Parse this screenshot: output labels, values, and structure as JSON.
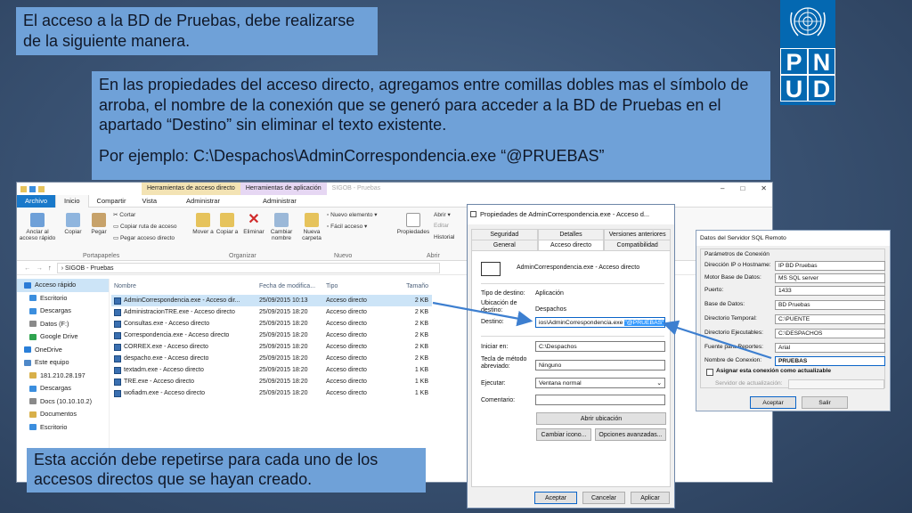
{
  "slide": {
    "heading": "El acceso a la BD de Pruebas, debe realizarse de la siguiente manera.",
    "instructions": "En las propiedades del acceso directo, agregamos entre comillas dobles mas el símbolo de arroba, el nombre de la conexión que se generó para acceder a la BD de Pruebas en el apartado “Destino” sin eliminar el texto existente.",
    "example": "Por ejemplo: C:\\Despachos\\AdminCorrespondencia.exe “@PRUEBAS”",
    "footer_note": "Esta acción debe repetirse para cada uno de los accesos directos que se hayan creado.",
    "logo_letters": [
      "P",
      "N",
      "U",
      "D"
    ]
  },
  "explorer": {
    "context_tabs": [
      "Herramientas de acceso directo",
      "Herramientas de aplicación",
      "SIGOB - Pruebas"
    ],
    "ribbon_tabs": [
      "Archivo",
      "Inicio",
      "Compartir",
      "Vista",
      "Administrar",
      "Administrar"
    ],
    "ribbon": {
      "pin_label": "Anclar al acceso rápido",
      "copy_label": "Copiar",
      "paste_label": "Pegar",
      "cut_label": "Cortar",
      "copy_path_label": "Copiar ruta de acceso",
      "paste_shortcut_label": "Pegar acceso directo",
      "move_to_label": "Mover a",
      "copy_to_label": "Copiar a",
      "delete_label": "Eliminar",
      "rename_label": "Cambiar nombre",
      "new_folder_label": "Nueva carpeta",
      "new_item_label": "Nuevo elemento",
      "easy_access_label": "Fácil acceso",
      "properties_label": "Propiedades",
      "open_label": "Abrir",
      "edit_label": "Editar",
      "history_label": "Historial",
      "groups": [
        "Portapapeles",
        "Organizar",
        "Nuevo",
        "Abrir"
      ]
    },
    "address_path": "SIGOB - Pruebas",
    "nav_items": [
      {
        "label": "Acceso rápido",
        "color": "#2b7bd6"
      },
      {
        "label": "Escritorio",
        "color": "#3b8ede"
      },
      {
        "label": "Descargas",
        "color": "#3b8ede"
      },
      {
        "label": "Datos (F:)",
        "color": "#8a8a8a"
      },
      {
        "label": "Google Drive",
        "color": "#2fa34f"
      },
      {
        "label": "OneDrive",
        "color": "#2a7fd8"
      },
      {
        "label": "Este equipo",
        "color": "#4e88c8"
      },
      {
        "label": "181.210.28.197",
        "color": "#d8b04a"
      },
      {
        "label": "Descargas",
        "color": "#3b8ede"
      },
      {
        "label": "Docs (10.10.10.2)",
        "color": "#8a8a8a"
      },
      {
        "label": "Documentos",
        "color": "#d8b04a"
      },
      {
        "label": "Escritorio",
        "color": "#3b8ede"
      }
    ],
    "columns": [
      "Nombre",
      "Fecha de modifica...",
      "Tipo",
      "Tamaño"
    ],
    "files": [
      {
        "name": "AdminCorrespondencia.exe - Acceso dir...",
        "date": "25/09/2015 10:13",
        "type": "Acceso directo",
        "size": "2 KB"
      },
      {
        "name": "AdministracionTRE.exe - Acceso directo",
        "date": "25/09/2015 18:20",
        "type": "Acceso directo",
        "size": "2 KB"
      },
      {
        "name": "Consultas.exe - Acceso directo",
        "date": "25/09/2015 18:20",
        "type": "Acceso directo",
        "size": "2 KB"
      },
      {
        "name": "Correspondencia.exe - Acceso directo",
        "date": "25/09/2015 18:20",
        "type": "Acceso directo",
        "size": "2 KB"
      },
      {
        "name": "CORREX.exe - Acceso directo",
        "date": "25/09/2015 18:20",
        "type": "Acceso directo",
        "size": "2 KB"
      },
      {
        "name": "despacho.exe - Acceso directo",
        "date": "25/09/2015 18:20",
        "type": "Acceso directo",
        "size": "2 KB"
      },
      {
        "name": "textadm.exe - Acceso directo",
        "date": "25/09/2015 18:20",
        "type": "Acceso directo",
        "size": "1 KB"
      },
      {
        "name": "TRE.exe - Acceso directo",
        "date": "25/09/2015 18:20",
        "type": "Acceso directo",
        "size": "1 KB"
      },
      {
        "name": "wofiadm.exe - Acceso directo",
        "date": "25/09/2015 18:20",
        "type": "Acceso directo",
        "size": "1 KB"
      }
    ]
  },
  "properties": {
    "title": "Propiedades de AdminCorrespondencia.exe - Acceso d...",
    "tabs_row1": [
      "Seguridad",
      "Detalles",
      "Versiones anteriores"
    ],
    "tabs_row2": [
      "General",
      "Acceso directo",
      "Compatibilidad"
    ],
    "shortcut_name": "AdminCorrespondencia.exe - Acceso directo",
    "target_type_label": "Tipo de destino:",
    "target_type": "Aplicación",
    "target_location_label": "Ubicación de destino:",
    "target_location": "Despachos",
    "target_label": "Destino:",
    "target_value": "ios\\AdminCorrespondencia.exe",
    "target_highlight": "\"@PRUEBAS\"",
    "start_in_label": "Iniciar en:",
    "start_in": "C:\\Despachos",
    "hotkey_label": "Tecla de método abreviado:",
    "hotkey": "Ninguno",
    "run_label": "Ejecutar:",
    "run": "Ventana normal",
    "comment_label": "Comentario:",
    "open_location_button": "Abrir ubicación",
    "change_icon_button": "Cambiar icono...",
    "advanced_button": "Opciones avanzadas...",
    "ok_button": "Aceptar",
    "cancel_button": "Cancelar",
    "apply_button": "Aplicar"
  },
  "sql_dialog": {
    "title": "Datos del Servidor SQL Remoto",
    "group_title": "Parámetros de Conexión",
    "fields": [
      {
        "label": "Dirección IP o Hostname:",
        "value": "IP BD Pruebas"
      },
      {
        "label": "Motor Base de Datos:",
        "value": "MS SQL server"
      },
      {
        "label": "Puerto:",
        "value": "1433"
      },
      {
        "label": "Base de Datos:",
        "value": "BD Pruebas"
      },
      {
        "label": "Directorio Temporal:",
        "value": "C:\\PUENTE"
      },
      {
        "label": "Directorio Ejecutables:",
        "value": "C:\\DESPACHOS"
      },
      {
        "label": "Fuente para Reportes:",
        "value": "Arial"
      },
      {
        "label": "Nombre de Conexion:",
        "value": "PRUEBAS"
      }
    ],
    "checkbox_label": "Asignar esta conexión como actualizable",
    "update_server_label": "Servidor de actualización:",
    "ok_button": "Aceptar",
    "exit_button": "Salir"
  },
  "colors": {
    "callout": "#6fa1d8",
    "logo": "#0468b1",
    "arrow": "#3d7fd0"
  }
}
